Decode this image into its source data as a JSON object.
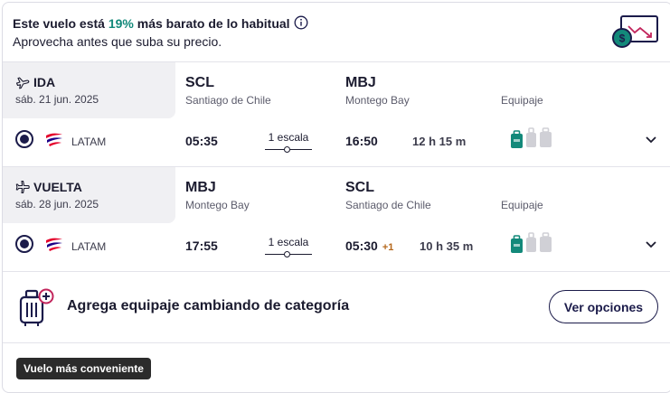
{
  "banner": {
    "text_before": "Este vuelo está ",
    "percent": "19%",
    "text_after": " más barato de lo habitual",
    "subtitle": "Aprovecha antes que suba su precio."
  },
  "segments": [
    {
      "label": "IDA",
      "date": "sáb. 21 jun. 2025",
      "origin_code": "SCL",
      "origin_city": "Santiago de Chile",
      "dest_code": "MBJ",
      "dest_city": "Montego Bay",
      "equipment_label": "Equipaje",
      "airline": "LATAM",
      "depart_time": "05:35",
      "stops": "1 escala",
      "arrive_time": "16:50",
      "day_offset": "",
      "duration": "12 h 15 m"
    },
    {
      "label": "VUELTA",
      "date": "sáb. 28 jun. 2025",
      "origin_code": "MBJ",
      "origin_city": "Montego Bay",
      "dest_code": "SCL",
      "dest_city": "Santiago de Chile",
      "equipment_label": "Equipaje",
      "airline": "LATAM",
      "depart_time": "17:55",
      "stops": "1 escala",
      "arrive_time": "05:30",
      "day_offset": "+1",
      "duration": "10 h 35 m"
    }
  ],
  "upsell": {
    "text": "Agrega equipaje cambiando de categoría",
    "button": "Ver opciones"
  },
  "badge": "Vuelo más conveniente",
  "colors": {
    "accent_green": "#13897a",
    "navy": "#1b1b4a",
    "bag_included": "#13897a",
    "bag_not_included": "#d0d0d6",
    "offset_orange": "#b5671b"
  }
}
